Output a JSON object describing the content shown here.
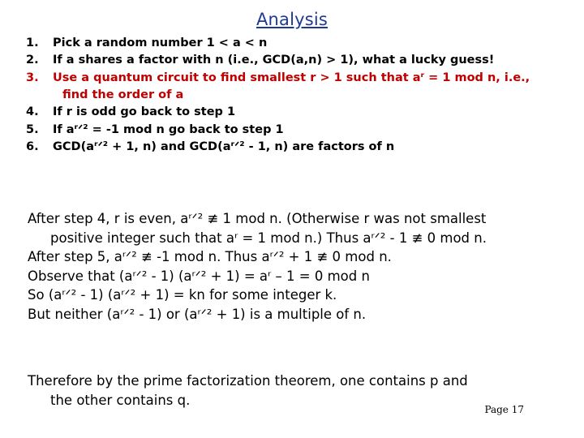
{
  "title": "Analysis",
  "colors": {
    "title": "#1F3A93",
    "highlight_step": "#C00000",
    "body": "#000000",
    "background": "#FFFFFF"
  },
  "steps": [
    {
      "number": "1.",
      "color": "black",
      "text": "Pick a random number 1 < a < n"
    },
    {
      "number": "2.",
      "color": "black",
      "text": "If a shares a factor with n (i.e., GCD(a,n) > 1), what a lucky guess!"
    },
    {
      "number": "3.",
      "color": "red",
      "text": "Use a quantum circuit to find smallest r > 1 such that aʳ = 1 mod n, i.e.,",
      "continuation": "find the order of a"
    },
    {
      "number": "4.",
      "color": "black",
      "text": "If r is odd go back to step 1"
    },
    {
      "number": "5.",
      "color": "black",
      "text": "If aʳᐟ² = -1 mod n go back to step 1"
    },
    {
      "number": "6.",
      "color": "black",
      "text": "GCD(aʳᐟ² + 1, n) and GCD(aʳᐟ² - 1, n) are factors of n"
    }
  ],
  "proof_lines": [
    {
      "text": "After step 4, r is even, aʳᐟ² ≢ 1 mod n.  (Otherwise r was not smallest",
      "continuation": "positive integer such that aʳ = 1 mod n.)  Thus aʳᐟ² - 1 ≢  0 mod n."
    },
    {
      "text": "After step 5, aʳᐟ² ≢ -1 mod n. Thus aʳᐟ² + 1 ≢  0 mod n."
    },
    {
      "text": "Observe that (aʳᐟ² - 1) (aʳᐟ² + 1) = aʳ – 1 = 0  mod n"
    },
    {
      "text": "So (aʳᐟ² - 1) (aʳᐟ² + 1) = kn for some integer k."
    },
    {
      "text": "But neither (aʳᐟ² - 1) or (aʳᐟ² + 1) is a multiple of n."
    }
  ],
  "conclusion": {
    "line1": "Therefore by the prime factorization theorem, one contains p and",
    "line2": "the other contains q."
  },
  "footer": {
    "page_label": "Page 17"
  }
}
